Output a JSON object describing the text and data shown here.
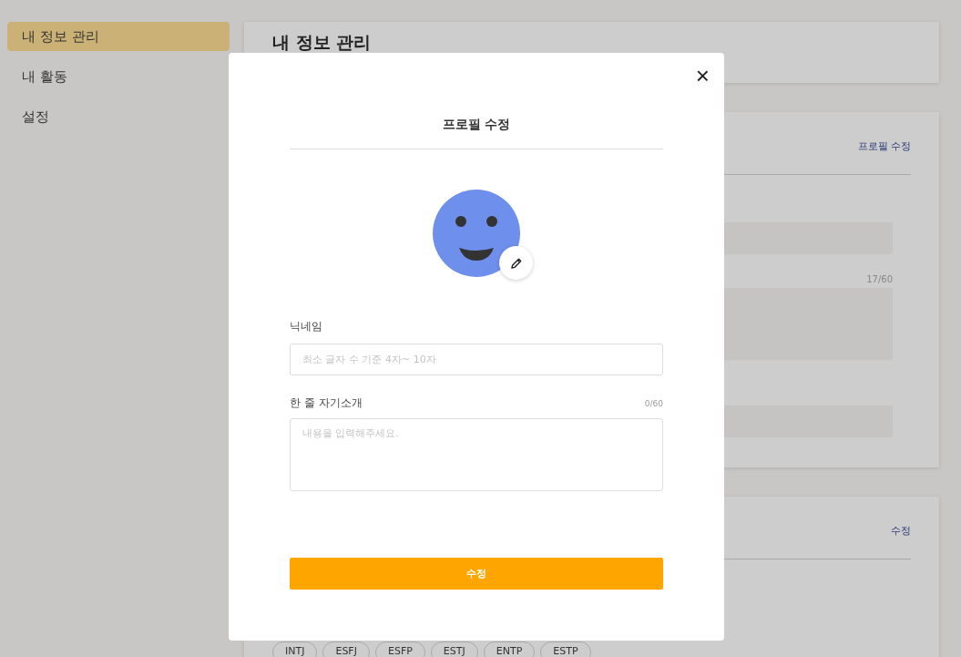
{
  "sidebar": {
    "items": [
      {
        "label": "내 정보 관리",
        "selected": true
      },
      {
        "label": "내 활동",
        "selected": false
      },
      {
        "label": "설정",
        "selected": false
      }
    ]
  },
  "page": {
    "title": "내 정보 관리",
    "profile_card": {
      "edit_link": "프로필 수정",
      "counter": "17/60"
    },
    "mbti_card": {
      "edit_link": "수정",
      "chips": [
        "INTJ",
        "ESFJ",
        "ESFP",
        "ESTJ",
        "ENTP",
        "ESTP"
      ]
    }
  },
  "modal": {
    "close": "×",
    "title": "프로필 수정",
    "nickname": {
      "label": "닉네임",
      "placeholder": "최소 글자 수 기준 4자~ 10자"
    },
    "intro": {
      "label": "한 줄 자기소개",
      "counter": "0/60",
      "placeholder": "내용을 입력해주세요."
    },
    "submit": "수정"
  }
}
